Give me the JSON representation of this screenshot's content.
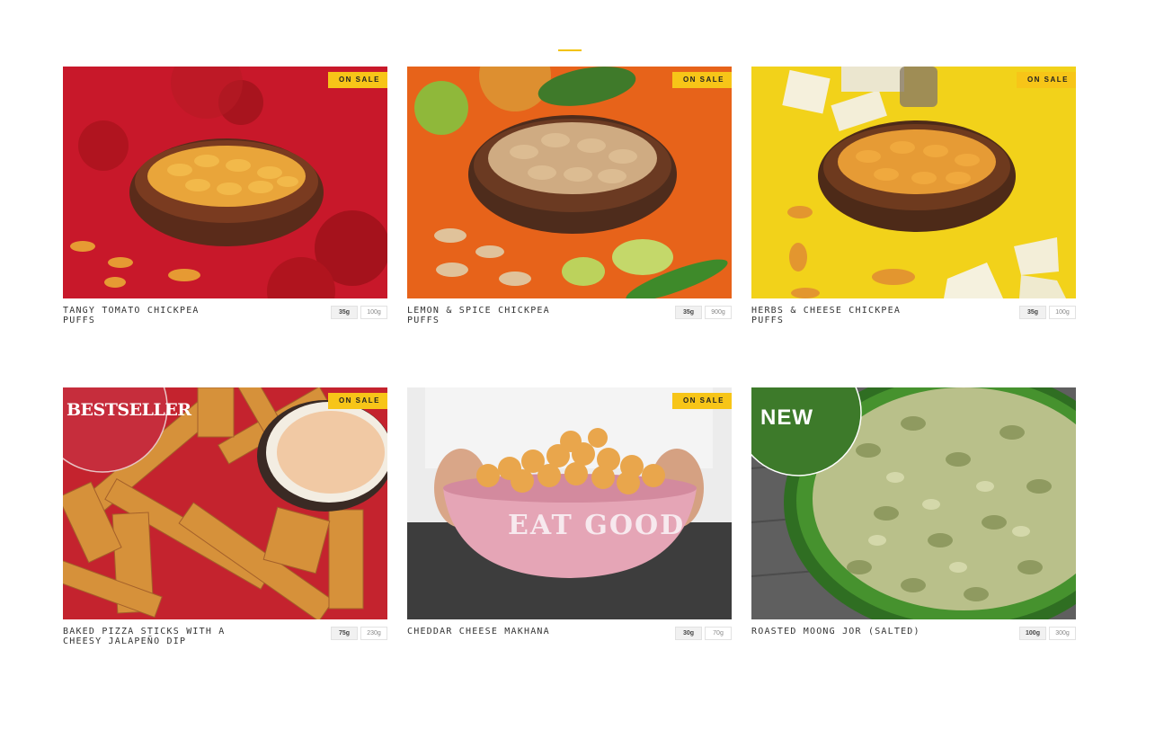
{
  "section": {
    "accent_color": "#f2c200"
  },
  "badges": {
    "sale": "ON SALE",
    "bestseller": "BESTSELLER",
    "new": "NEW"
  },
  "products": [
    {
      "name": "TANGY TOMATO CHICKPEA PUFFS",
      "sizes": [
        "35g",
        "100g"
      ],
      "on_sale": true,
      "bg_color": "#c8182a"
    },
    {
      "name": "LEMON & SPICE CHICKPEA PUFFS",
      "sizes": [
        "35g",
        "900g"
      ],
      "on_sale": true,
      "bg_color": "#e7631a"
    },
    {
      "name": "HERBS & CHEESE CHICKPEA PUFFS",
      "sizes": [
        "35g",
        "100g"
      ],
      "on_sale": true,
      "bg_color": "#f2d21a"
    },
    {
      "name": "BAKED PIZZA STICKS WITH A CHEESY JALAPEÑO DIP",
      "sizes": [
        "75g",
        "230g"
      ],
      "on_sale": true,
      "bg_color": "#c4232e",
      "label": "BESTSELLER"
    },
    {
      "name": "CHEDDAR CHEESE MAKHANA",
      "sizes": [
        "30g",
        "70g"
      ],
      "on_sale": true,
      "bg_color": "#eeeeee",
      "bowl_text": "EAT GOOD"
    },
    {
      "name": "ROASTED MOONG JOR (SALTED)",
      "sizes": [
        "100g",
        "300g"
      ],
      "on_sale": false,
      "bg_color": "#5f5f5f",
      "label": "NEW"
    }
  ]
}
